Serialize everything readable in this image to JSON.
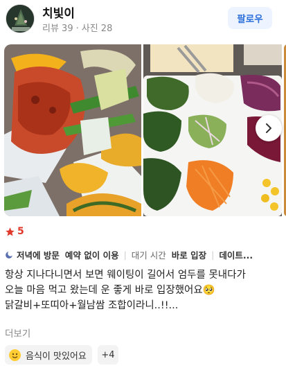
{
  "profile": {
    "name": "치빛이",
    "reviews_label": "리뷰 39",
    "photos_label": "사진 28",
    "follow_label": "팔로우"
  },
  "rating": {
    "value": "5"
  },
  "tags": {
    "visit_time": "저녁에 방문",
    "reservation": "예약 없이 이용",
    "wait_prefix": "대기 시간",
    "wait_value": "바로 입장",
    "purpose": "데이트..."
  },
  "review": {
    "line1": "항상 지나다니면서 보면 웨이팅이 길어서 엄두를 못내다가",
    "line2": "오늘 마음 먹고 왔는데 운 좋게 바로 입장했어요🥺",
    "line3": "닭갈비+또띠아+월남쌈 조합이라니..!!...",
    "more_label": "더보기"
  },
  "keywords": {
    "chip1": "음식이 맛있어요",
    "chip2": "+4"
  },
  "colors": {
    "accent": "#2a6fdb",
    "star": "#e0392b"
  },
  "icons": [
    "moon-icon",
    "star-icon",
    "chevron-right-icon",
    "smile-emoji-icon"
  ]
}
